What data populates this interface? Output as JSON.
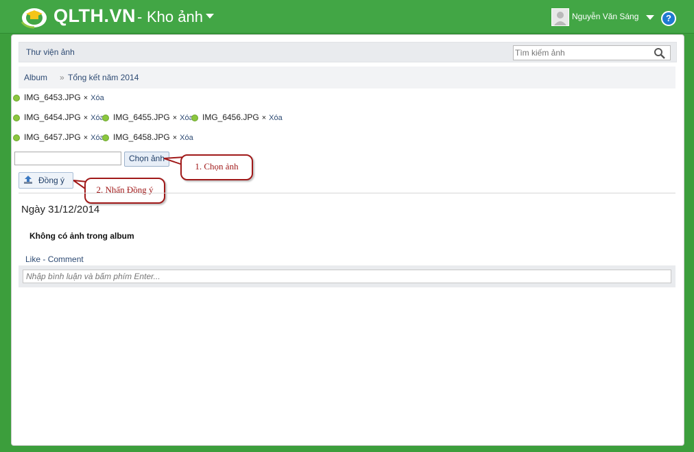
{
  "header": {
    "brand": "QLTH.VN",
    "separator": "-",
    "module": "Kho ảnh",
    "user_name": "Nguyễn Văn Sáng",
    "help_label": "?"
  },
  "panel": {
    "title": "Thư viện ảnh",
    "search_placeholder": "Tìm kiếm ảnh",
    "breadcrumb": {
      "root": "Album",
      "sep": "»",
      "current": "Tổng kết năm 2014"
    }
  },
  "uploads": {
    "files": [
      {
        "name": "IMG_6453.JPG",
        "x": "×",
        "delete": "Xóa"
      },
      {
        "name": "IMG_6454.JPG",
        "x": "×",
        "delete": "Xóa"
      },
      {
        "name": "IMG_6455.JPG",
        "x": "×",
        "delete": "Xóa"
      },
      {
        "name": "IMG_6456.JPG",
        "x": "×",
        "delete": "Xóa"
      },
      {
        "name": "IMG_6457.JPG",
        "x": "×",
        "delete": "Xóa"
      },
      {
        "name": "IMG_6458.JPG",
        "x": "×",
        "delete": "Xóa"
      }
    ],
    "choose_button": "Chọn ảnh",
    "agree_button": "Đồng ý"
  },
  "callouts": {
    "step1": "1. Chọn ảnh",
    "step2": "2. Nhấn Đồng ý"
  },
  "album": {
    "date": "Ngày 31/12/2014",
    "empty_message": "Không có ảnh trong album",
    "like": "Like",
    "dash": " - ",
    "comment": "Comment",
    "comment_placeholder": "Nhập bình luận và bấm phím Enter..."
  },
  "colors": {
    "header_green": "#42a645",
    "link_blue": "#2d4a73",
    "callout_red": "#a01818",
    "dot_green": "#8cc63f"
  }
}
